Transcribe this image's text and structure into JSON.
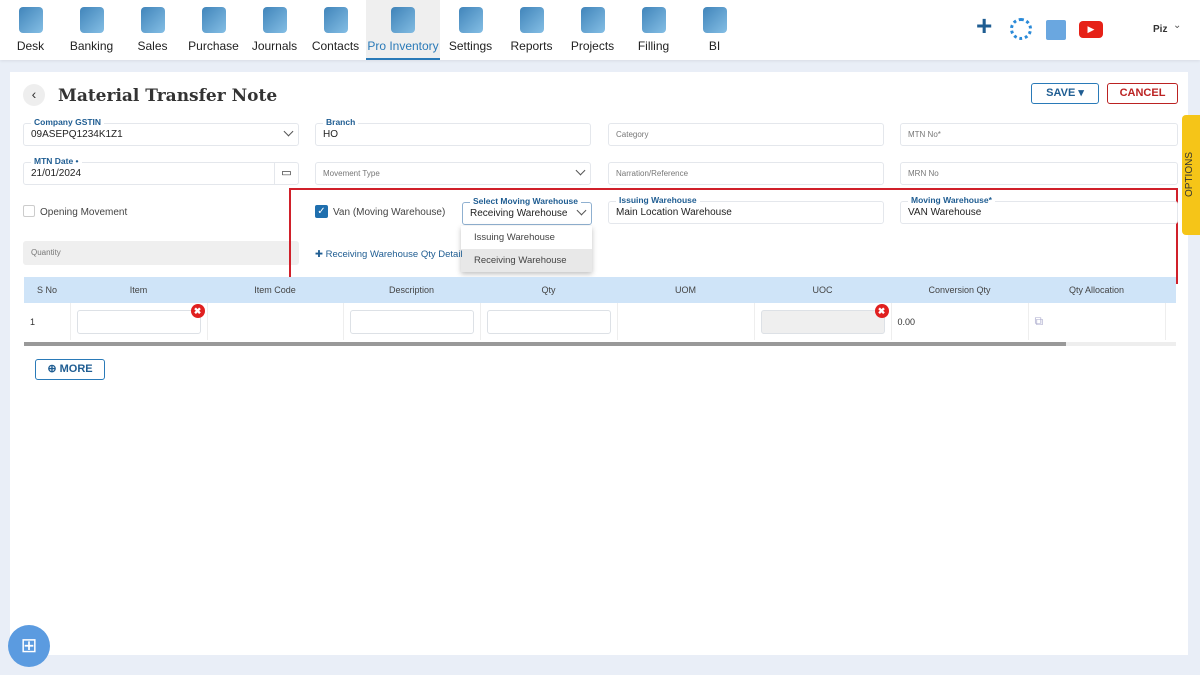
{
  "nav": {
    "items": [
      {
        "label": "Desk",
        "icon": "desk-icon"
      },
      {
        "label": "Banking",
        "icon": "bank-icon"
      },
      {
        "label": "Sales",
        "icon": "sales-icon"
      },
      {
        "label": "Purchase",
        "icon": "purchase-icon"
      },
      {
        "label": "Journals",
        "icon": "journals-icon"
      },
      {
        "label": "Contacts",
        "icon": "contacts-icon"
      },
      {
        "label": "Pro Inventory",
        "icon": "inventory-icon",
        "active": true
      },
      {
        "label": "Settings",
        "icon": "settings-icon"
      },
      {
        "label": "Reports",
        "icon": "reports-icon"
      },
      {
        "label": "Projects",
        "icon": "projects-icon"
      },
      {
        "label": "Filling",
        "icon": "filling-icon"
      },
      {
        "label": "BI",
        "icon": "bi-icon"
      }
    ],
    "user": "Piz",
    "accent": "#2a7ab8"
  },
  "page": {
    "title": "Material Transfer Note",
    "save": "SAVE",
    "cancel": "CANCEL",
    "options": "OPTIONS"
  },
  "form": {
    "company_gstin": {
      "label": "Company GSTIN",
      "value": "09ASEPQ1234K1Z1"
    },
    "branch": {
      "label": "Branch",
      "value": "HO"
    },
    "category": {
      "placeholder": "Category"
    },
    "mtn_no": {
      "placeholder": "MTN No*"
    },
    "mtn_date": {
      "label": "MTN Date •",
      "value": "21/01/2024"
    },
    "movement_type": {
      "placeholder": "Movement Type"
    },
    "narration": {
      "placeholder": "Narration/Reference"
    },
    "mrn_no": {
      "placeholder": "MRN No"
    },
    "opening_movement": {
      "label": "Opening Movement",
      "checked": false
    },
    "van": {
      "label": "Van (Moving Warehouse)",
      "checked": true
    },
    "select_moving": {
      "label": "Select Moving Warehouse",
      "value": "Receiving Warehouse",
      "options": [
        "Issuing Warehouse",
        "Receiving Warehouse"
      ]
    },
    "issuing": {
      "label": "Issuing Warehouse",
      "value": "Main Location Warehouse"
    },
    "moving": {
      "label": "Moving Warehouse*",
      "value": "VAN Warehouse"
    },
    "quantity": {
      "placeholder": "Quantity"
    },
    "receiving_qty_link": "Receiving Warehouse Qty Detail"
  },
  "table": {
    "headers": [
      "S No",
      "Item",
      "Item Code",
      "Description",
      "Qty",
      "UOM",
      "UOC",
      "Conversion Qty",
      "Qty Allocation"
    ],
    "rows": [
      {
        "sno": "1",
        "conversion_qty": "0.00"
      }
    ]
  },
  "more": "MORE"
}
